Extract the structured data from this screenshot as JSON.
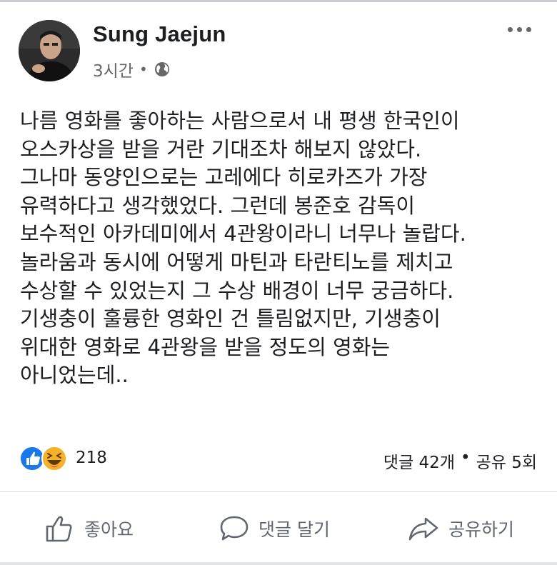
{
  "post": {
    "author": "Sung Jaejun",
    "time": "3시간",
    "separator": "•",
    "visibility_icon": "globe-icon",
    "more_icon": "more-dots-icon",
    "text_lines": [
      "나름 영화를 좋아하는 사람으로서 내 평생 한국인이",
      "오스카상을 받을 거란 기대조차 해보지 않았다.",
      "그나마 동양인으로는 고레에다 히로카즈가 가장",
      "유력하다고 생각했었다. 그런데 봉준호 감독이",
      "보수적인 아카데미에서 4관왕이라니 너무나 놀랍다.",
      "놀라움과 동시에 어떻게 마틴과 타란티노를 제치고",
      "수상할 수 있었는지 그 수상 배경이 너무 궁금하다.",
      "기생충이 훌륭한 영화인 건 틀림없지만, 기생충이",
      "위대한 영화로 4관왕을 받을 정도의 영화는",
      "아니었는데.."
    ]
  },
  "stats": {
    "reactions": [
      "like-reaction-icon",
      "haha-reaction-icon"
    ],
    "reaction_count": "218",
    "comments": "댓글 42개",
    "separator": "•",
    "shares": "공유 5회"
  },
  "actions": {
    "like": "좋아요",
    "comment": "댓글 달기",
    "share": "공유하기"
  },
  "colors": {
    "text": "#1c1e21",
    "secondary": "#65676b",
    "like_blue": "#1877f2",
    "haha_yellow": "#f7b125",
    "divider": "#d9dbde"
  }
}
